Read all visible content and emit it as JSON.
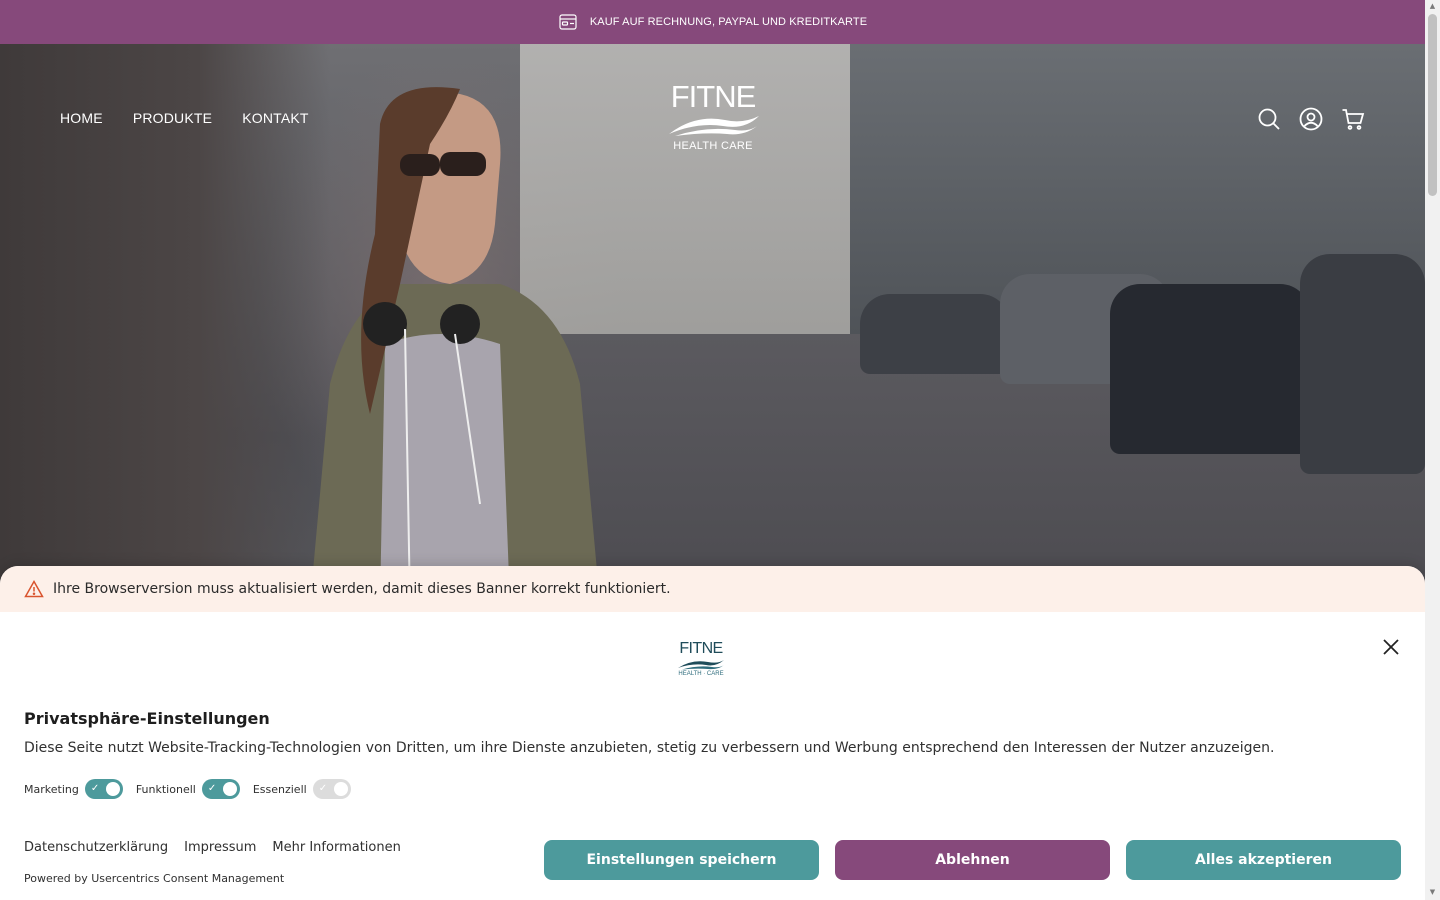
{
  "announcement": {
    "text": "KAUF AUF RECHNUNG, PAYPAL UND KREDITKARTE",
    "icon": "payment-card-icon"
  },
  "header": {
    "nav": [
      {
        "label": "HOME"
      },
      {
        "label": "PRODUKTE"
      },
      {
        "label": "KONTAKT"
      }
    ],
    "logo": {
      "word": "FITNE",
      "sub": "HEALTH CARE"
    },
    "icons": [
      "search-icon",
      "account-icon",
      "cart-icon"
    ]
  },
  "consent": {
    "warning": "Ihre Browserversion muss aktualisiert werden, damit dieses Banner korrekt funktioniert.",
    "logo": {
      "word": "FITNE",
      "sub": "HEALTH · CARE"
    },
    "title": "Privatsphäre-Einstellungen",
    "description": "Diese Seite nutzt Website-Tracking-Technologien von Dritten, um ihre Dienste anzubieten, stetig zu verbessern und Werbung entsprechend den Interessen der Nutzer anzuzeigen.",
    "toggles": [
      {
        "label": "Marketing",
        "checked": true
      },
      {
        "label": "Funktionell",
        "checked": true
      },
      {
        "label": "Essenziell",
        "checked": true,
        "disabled": true
      }
    ],
    "links": [
      "Datenschutzerklärung",
      "Impressum",
      "Mehr Informationen"
    ],
    "powered_by": "Powered by Usercentrics Consent Management",
    "buttons": {
      "save": "Einstellungen speichern",
      "deny": "Ablehnen",
      "accept": "Alles akzeptieren"
    }
  },
  "colors": {
    "brand_plum": "#86497b",
    "brand_teal": "#4d9a9c",
    "warning_bg": "#fdf0e9"
  }
}
